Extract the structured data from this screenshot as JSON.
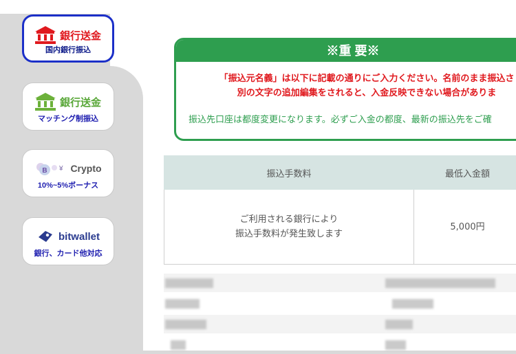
{
  "sidebar": {
    "cards": [
      {
        "title": "銀行送金",
        "sub": "国内銀行振込",
        "title_color": "#e0191e",
        "icon": "bank-icon",
        "icon_color": "#e0191e",
        "active": true
      },
      {
        "title": "銀行送金",
        "sub": "マッチング制振込",
        "title_color": "#5aa83a",
        "icon": "bank-icon",
        "icon_color": "#6cb13a",
        "active": false
      },
      {
        "title": "Crypto",
        "sub": "10%~5%ボーナス",
        "title_color": "#555555",
        "icon": "crypto-coins-icon",
        "active": false
      },
      {
        "title": "bitwallet",
        "sub": "銀行、カード他対応",
        "title_color": "#2a3b8f",
        "icon": "bitwallet-logo-icon",
        "active": false
      }
    ]
  },
  "notice": {
    "heading": "※重 要※",
    "red_line1": "「振込元名義」は以下に記載の通りにご入力ください。名前のまま振込さ",
    "red_line2": "別の文字の追加編集をされると、入金反映できない場合がありま",
    "green_line": "振込先口座は都度変更になります。必ずご入金の都度、最新の振込先をご確"
  },
  "fee_table": {
    "headers": [
      "振込手数料",
      "最低入金額"
    ],
    "row": [
      "ご利用される銀行により\n振込手数料が発生致します",
      "5,000円"
    ]
  },
  "colors": {
    "accent_green": "#2e9e4f",
    "accent_red": "#e0191e",
    "active_border": "#1b2fc8"
  }
}
